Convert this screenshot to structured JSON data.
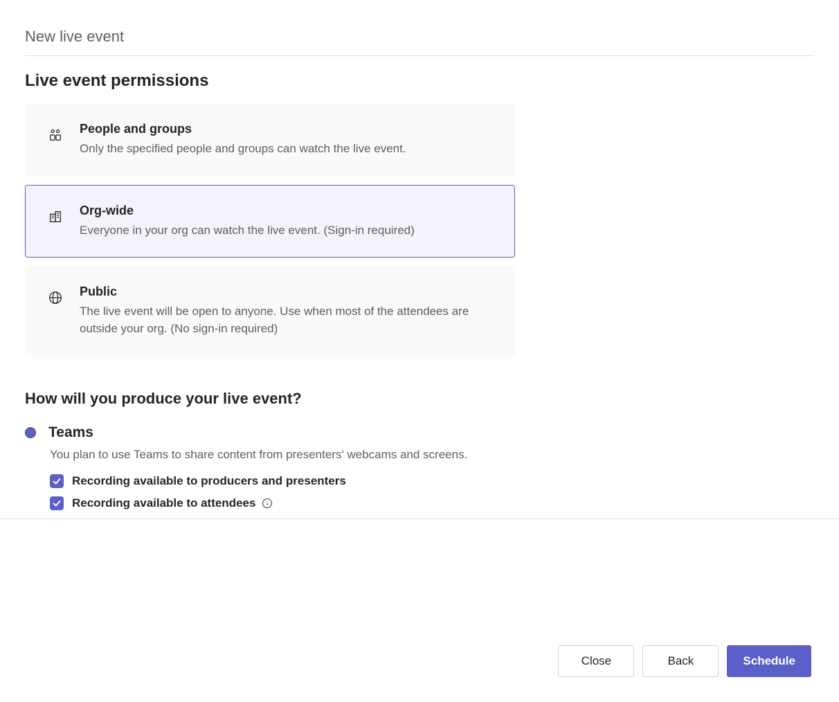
{
  "dialog": {
    "title": "New live event"
  },
  "permissions": {
    "heading": "Live event permissions",
    "options": [
      {
        "title": "People and groups",
        "desc": "Only the specified people and groups can watch the live event."
      },
      {
        "title": "Org-wide",
        "desc": "Everyone in your org can watch the live event. (Sign-in required)"
      },
      {
        "title": "Public",
        "desc": "The live event will be open to anyone. Use when most of the attendees are outside your org. (No sign-in required)"
      }
    ],
    "selected_index": 1
  },
  "production": {
    "heading": "How will you produce your live event?",
    "option_label": "Teams",
    "option_desc": "You plan to use Teams to share content from presenters' webcams and screens.",
    "checkboxes": [
      {
        "label": "Recording available to producers and presenters",
        "checked": true,
        "has_info": false
      },
      {
        "label": "Recording available to attendees",
        "checked": true,
        "has_info": true
      }
    ]
  },
  "footer": {
    "close": "Close",
    "back": "Back",
    "schedule": "Schedule"
  }
}
